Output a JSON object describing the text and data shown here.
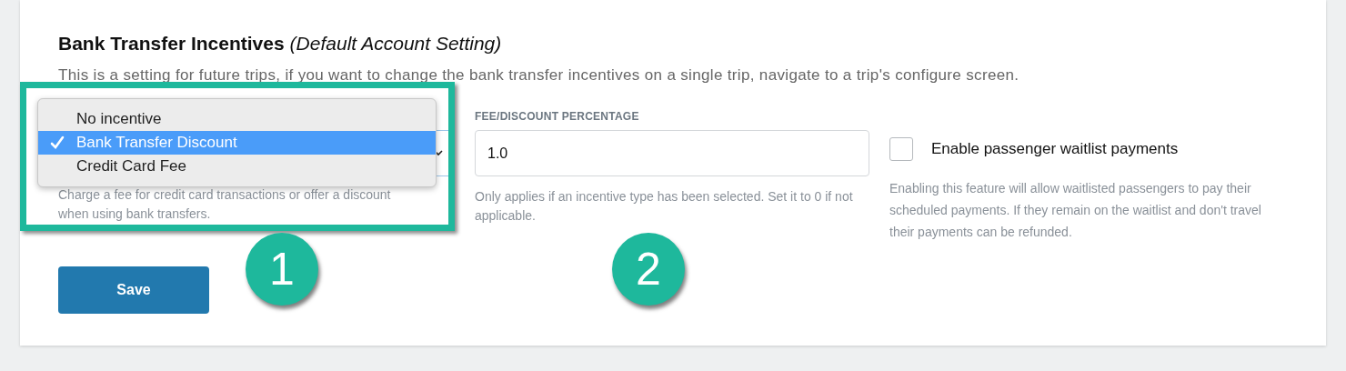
{
  "heading": {
    "title": "Bank Transfer Incentives",
    "subtitle": "(Default Account Setting)"
  },
  "description": "This is a setting for future trips, if you want to change the bank transfer incentives on a single trip, navigate to a trip's configure screen.",
  "incentive_select": {
    "help": "Charge a fee for credit card transactions or offer a discount when using bank transfers.",
    "options": [
      {
        "label": "No incentive",
        "selected": false
      },
      {
        "label": "Bank Transfer Discount",
        "selected": true
      },
      {
        "label": "Credit Card Fee",
        "selected": false
      }
    ]
  },
  "percentage": {
    "label": "FEE/DISCOUNT PERCENTAGE",
    "value": "1.0",
    "help": "Only applies if an incentive type has been selected. Set it to 0 if not applicable."
  },
  "waitlist": {
    "label": "Enable passenger waitlist payments",
    "checked": false,
    "help": "Enabling this feature will allow waitlisted passengers to pay their scheduled payments. If they remain on the waitlist and don't travel their payments can be refunded."
  },
  "save_button": "Save",
  "callouts": [
    "1",
    "2"
  ]
}
